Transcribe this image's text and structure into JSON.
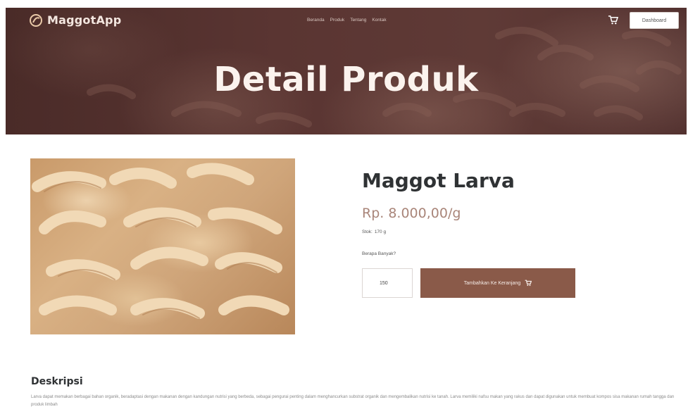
{
  "navbar": {
    "brand": "MaggotApp",
    "links": [
      "Beranda",
      "Produk",
      "Tentang",
      "Kontak"
    ],
    "dashboard_label": "Dashboard"
  },
  "hero": {
    "title": "Detail Produk"
  },
  "product": {
    "name": "Maggot Larva",
    "price": "Rp. 8.000,00/g",
    "stock_label": "Stok:",
    "stock_value": "170 g",
    "quantity_label": "Berapa Banyak?",
    "quantity_value": "150",
    "add_to_cart_label": "Tambahkan Ke Keranjang"
  },
  "description": {
    "heading": "Deskripsi",
    "text": "Larva dapat memakan berbagai bahan organik, beradaptasi dengan makanan dengan kandungan nutrisi yang berbeda, sebagai pengurai penting dalam menghancurkan substrat organik dan mengembalikan nutrisi ke tanah. Larva memiliki nafsu makan yang rakus dan dapat digunakan untuk membuat kompos sisa makanan rumah tangga dan produk limbah"
  },
  "colors": {
    "hero_bg": "#5a3532",
    "accent": "#8a5a49",
    "price": "#a98579",
    "title_text": "#2f3234"
  },
  "icons": {
    "brand": "leaf-logo-icon",
    "nav_cart": "cart-icon",
    "button_cart": "cart-icon"
  }
}
